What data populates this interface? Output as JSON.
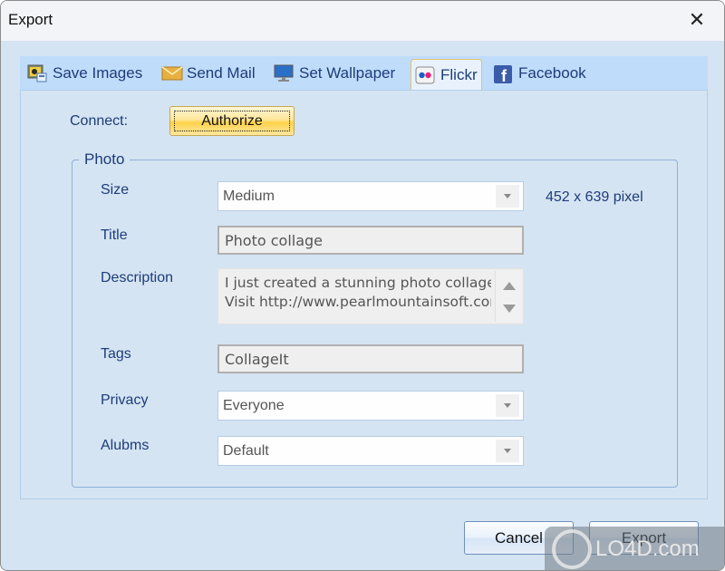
{
  "window": {
    "title": "Export",
    "close_label": "✕"
  },
  "tabs": [
    {
      "label": "Save Images",
      "icon": "save-images-icon",
      "active": false
    },
    {
      "label": "Send Mail",
      "icon": "envelope-icon",
      "active": false
    },
    {
      "label": "Set Wallpaper",
      "icon": "monitor-icon",
      "active": false
    },
    {
      "label": "Flickr",
      "icon": "flickr-icon",
      "active": true
    },
    {
      "label": "Facebook",
      "icon": "facebook-icon",
      "active": false
    }
  ],
  "connect": {
    "label": "Connect:",
    "authorize_label": "Authorize"
  },
  "photo_group": {
    "title": "Photo",
    "dimensions": "452 x 639 pixel",
    "fields": {
      "size": {
        "label": "Size",
        "value": "Medium"
      },
      "title": {
        "label": "Title",
        "value": "Photo collage"
      },
      "description": {
        "label": "Description",
        "lines": [
          "I just created a stunning photo collage",
          "Visit http://www.pearlmountainsoft.com"
        ]
      },
      "tags": {
        "label": "Tags",
        "value": "CollageIt"
      },
      "privacy": {
        "label": "Privacy",
        "value": "Everyone"
      },
      "albums": {
        "label": "Alubms",
        "value": "Default"
      }
    }
  },
  "footer": {
    "cancel_label": "Cancel",
    "export_label": "Export"
  },
  "watermark": {
    "text": "LO4D.com"
  },
  "colors": {
    "accent_text": "#1d3c7a",
    "tab_strip": "#c0dcfb",
    "dialog_bg": "#d5e4f2",
    "authorize_gold": "#ffd24a"
  }
}
